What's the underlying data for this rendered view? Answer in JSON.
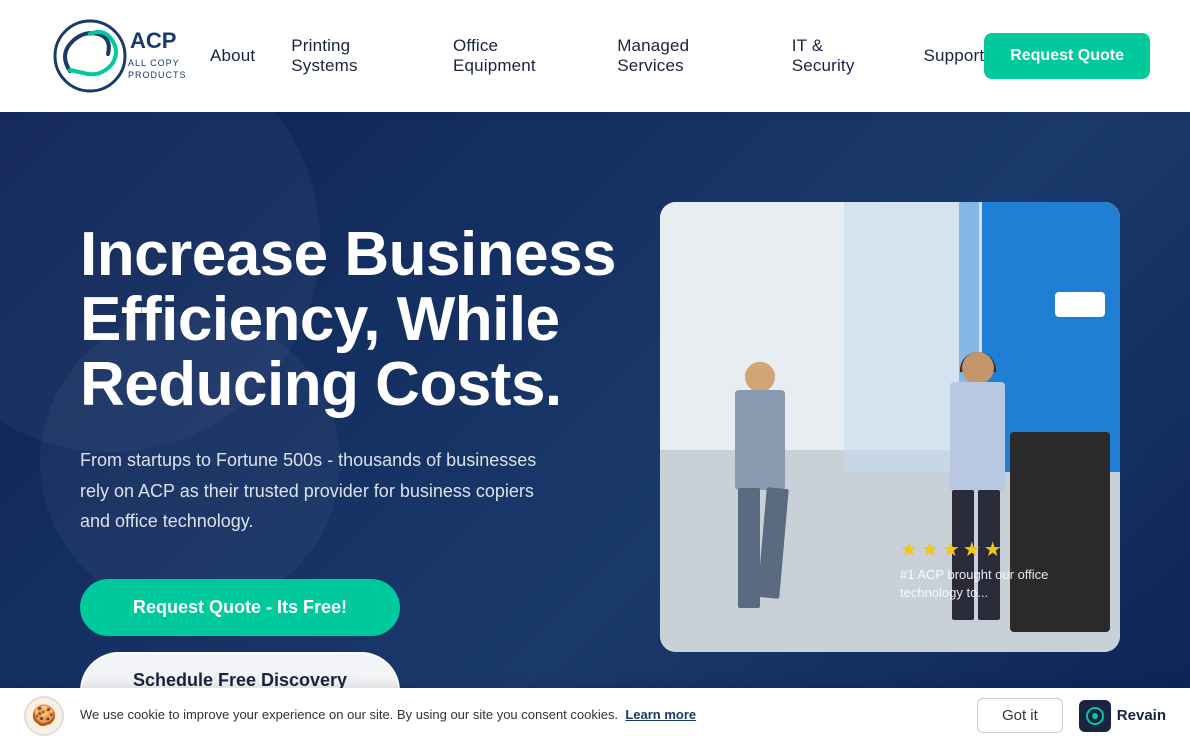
{
  "brand": {
    "name": "ACP All Copy Products",
    "logo_alt": "ACP Logo"
  },
  "navbar": {
    "links": [
      {
        "id": "about",
        "label": "About"
      },
      {
        "id": "printing-systems",
        "label": "Printing Systems"
      },
      {
        "id": "office-equipment",
        "label": "Office Equipment"
      },
      {
        "id": "managed-services",
        "label": "Managed Services"
      },
      {
        "id": "it-security",
        "label": "IT & Security"
      },
      {
        "id": "support",
        "label": "Support"
      }
    ],
    "cta_label": "Request Quote"
  },
  "hero": {
    "title": "Increase Business Efficiency, While Reducing Costs.",
    "subtitle": "From startups to Fortune 500s - thousands of businesses rely on ACP as their trusted provider for business copiers and office technology.",
    "cta_primary": "Request Quote - Its Free!",
    "cta_secondary": "Schedule Free Discovery Meeting"
  },
  "review": {
    "stars": 5,
    "stars_display": "★★★★★",
    "snippet": "#1 ACP brought our office technology to..."
  },
  "cookie": {
    "icon": "🍪",
    "text": "We use cookie to improve your experience on our site. By using our site you consent cookies.",
    "learn_more": "Learn more",
    "got_it": "Got it",
    "revain_label": "Revain"
  }
}
